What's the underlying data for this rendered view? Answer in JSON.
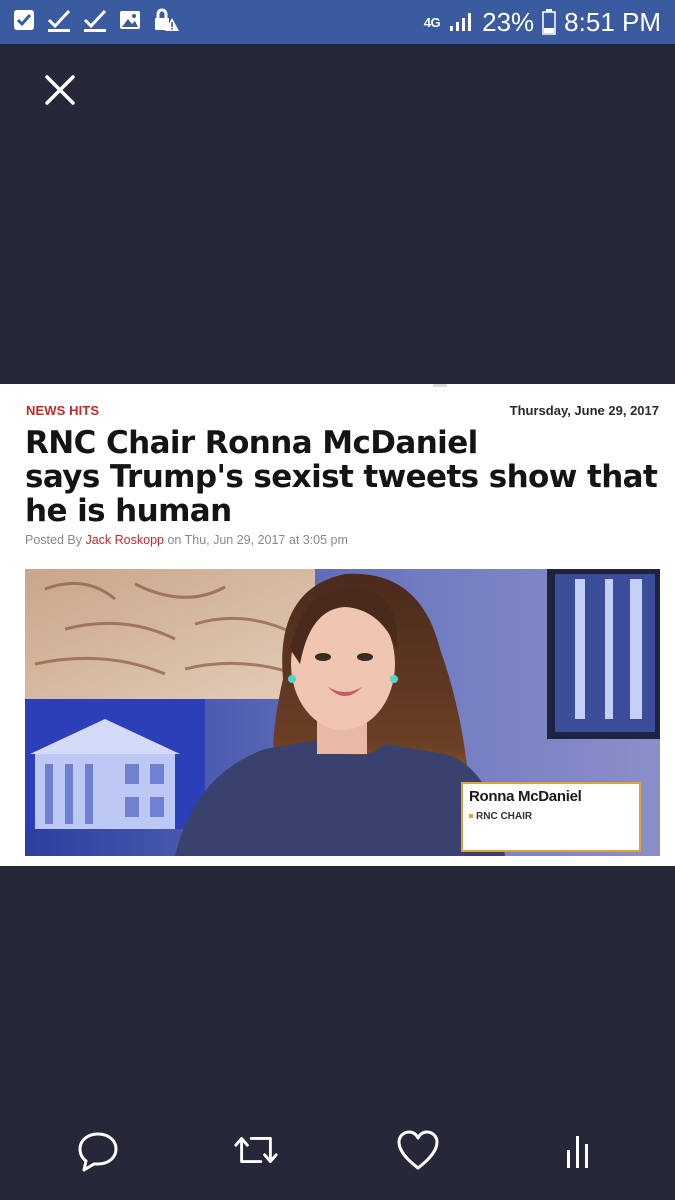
{
  "status_bar": {
    "network": "4G",
    "battery": "23%",
    "time": "8:51 PM",
    "left_icons": [
      "mail-check-icon",
      "check-icon",
      "check-icon",
      "image-icon",
      "lock-warning-icon"
    ]
  },
  "viewer": {
    "close_icon": "close-icon"
  },
  "article": {
    "category": "NEWS HITS",
    "date": "Thursday, June 29, 2017",
    "headline_line1": "RNC Chair Ronna McDaniel",
    "headline_line2": "says Trump's sexist tweets show that",
    "headline_line3": "he is human",
    "byline_prefix": "Posted By",
    "author": "Jack Roskopp",
    "byline_suffix": "on Thu, Jun 29, 2017 at 3:05 pm",
    "photo": {
      "lower_third_name": "Ronna McDaniel",
      "lower_third_title": "RNC CHAIR"
    }
  },
  "actions": {
    "reply_icon": "reply-icon",
    "retweet_icon": "retweet-icon",
    "like_icon": "heart-icon",
    "analytics_icon": "analytics-icon"
  },
  "colors": {
    "status_bar": "#3a5ba0",
    "background": "#262739",
    "category": "#c22a2a",
    "lower_third_border": "#e0a13a"
  }
}
